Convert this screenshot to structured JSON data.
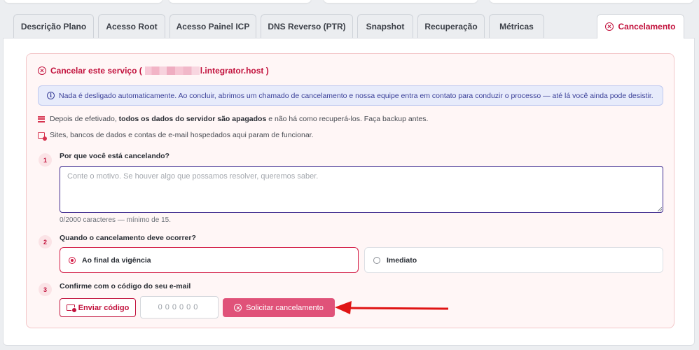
{
  "tabs": [
    {
      "label": "Descrição Plano"
    },
    {
      "label": "Acesso Root"
    },
    {
      "label": "Acesso Painel ICP"
    },
    {
      "label": "DNS Reverso (PTR)"
    },
    {
      "label": "Snapshot"
    },
    {
      "label": "Recuperação"
    },
    {
      "label": "Métricas"
    },
    {
      "label": "Cancelamento",
      "active": true
    }
  ],
  "cancel": {
    "title_prefix": "Cancelar este serviço (",
    "title_host": "l.integrator.host )",
    "info": "Nada é desligado automaticamente. Ao concluir, abrimos um chamado de cancelamento e nossa equipe entra em contato para conduzir o processo — até lá você ainda pode desistir.",
    "warning1_pre": "Depois de efetivado,",
    "warning1_bold": "todos os dados do servidor são apagados",
    "warning1_post": "e não há como recuperá-los. Faça backup antes.",
    "warning2": "Sites, bancos de dados e contas de e-mail hospedados aqui param de funcionar.",
    "steps": [
      {
        "number": "1",
        "label": "Por que você está cancelando?"
      },
      {
        "number": "2",
        "label": "Quando o cancelamento deve ocorrer?"
      },
      {
        "number": "3",
        "label": "Confirme com o código do seu e-mail"
      }
    ],
    "reason_placeholder": "Conte o motivo. Se houver algo que possamos resolver, queremos saber.",
    "reason_value": "",
    "counter": "0/2000 caracteres — mínimo de 15.",
    "options": [
      {
        "label": "Ao final da vigência",
        "selected": true
      },
      {
        "label": "Imediato",
        "selected": false
      }
    ],
    "send_code_label": "Enviar código",
    "code_placeholder": "000000",
    "submit_label": "Solicitar cancelamento"
  },
  "colors": {
    "accent": "#c2123d",
    "submit_bg": "#e05279",
    "arrow": "#e01414",
    "info_bg": "#e7ebfb"
  }
}
